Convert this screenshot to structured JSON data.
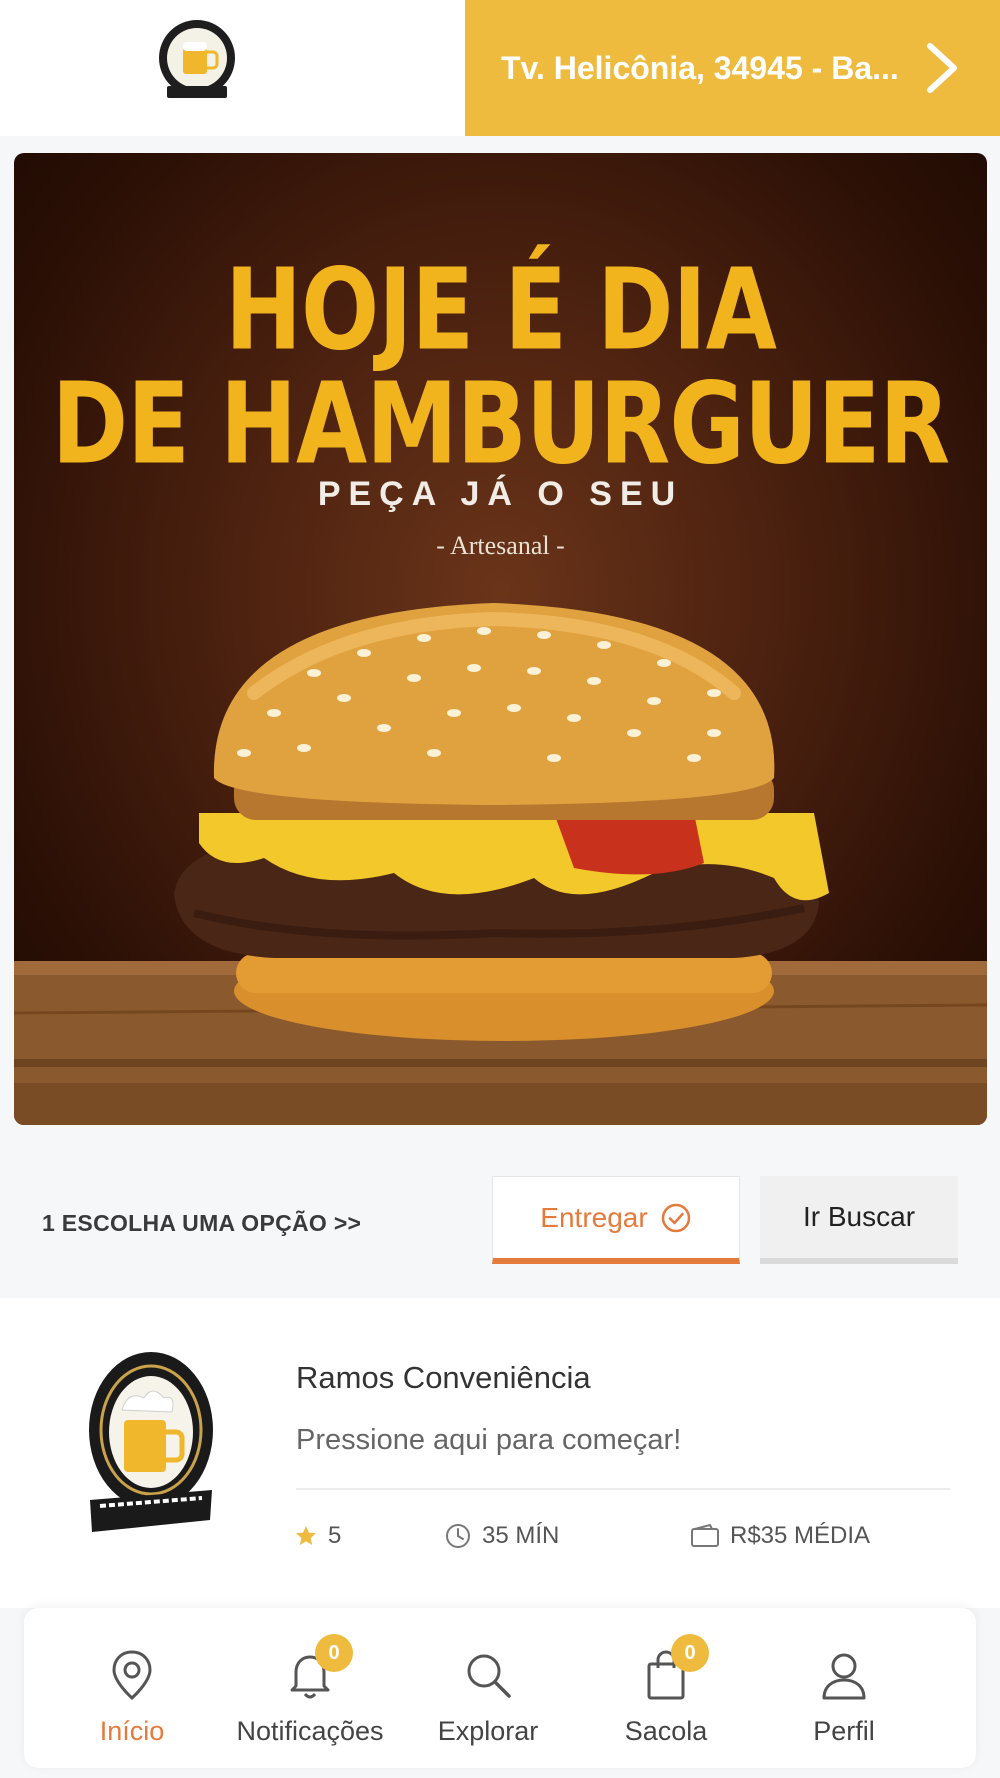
{
  "header": {
    "address": "Tv. Helicônia, 34945 - Ba...",
    "colors": {
      "accent": "#efbb3e"
    }
  },
  "banner": {
    "title_line1": "HOJE É DIA",
    "title_line2": "DE HAMBURGUER",
    "subtitle": "PEÇA JÁ O SEU",
    "tagline": "- Artesanal -"
  },
  "delivery": {
    "prompt": "1 ESCOLHA UMA OPÇÃO >>",
    "options": [
      {
        "label": "Entregar",
        "selected": true
      },
      {
        "label": "Ir Buscar",
        "selected": false
      }
    ],
    "selected_color": "#e47a3c"
  },
  "store": {
    "name": "Ramos Conveniência",
    "tagline": "Pressione aqui para começar!",
    "rating": "5",
    "time": "35 MÍN",
    "average": "R$35 MÉDIA"
  },
  "nav": {
    "items": [
      {
        "label": "Início",
        "icon": "location-pin-icon",
        "active": true
      },
      {
        "label": "Notificações",
        "icon": "bell-icon",
        "badge": "0"
      },
      {
        "label": "Explorar",
        "icon": "search-icon"
      },
      {
        "label": "Sacola",
        "icon": "shopping-bag-icon",
        "badge": "0"
      },
      {
        "label": "Perfil",
        "icon": "user-icon"
      }
    ]
  }
}
